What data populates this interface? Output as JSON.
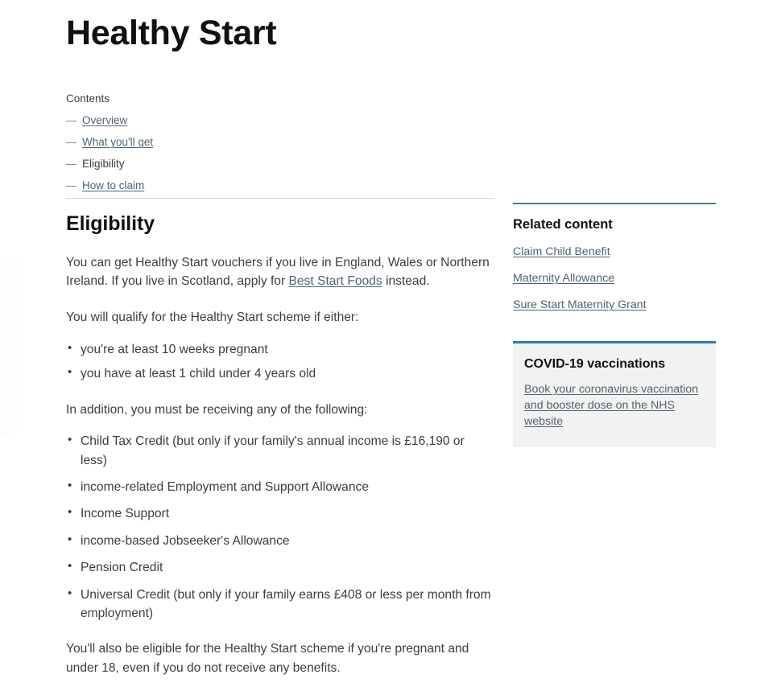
{
  "page": {
    "title": "Healthy Start"
  },
  "contents": {
    "label": "Contents",
    "dash": "—",
    "items": [
      {
        "label": "Overview",
        "current": false
      },
      {
        "label": "What you'll get",
        "current": false
      },
      {
        "label": "Eligibility",
        "current": true
      },
      {
        "label": "How to claim",
        "current": false
      }
    ]
  },
  "main": {
    "section_title": "Eligibility",
    "intro_before_link": "You can get Healthy Start vouchers if you live in England, Wales or Northern Ireland. If you live in Scotland, apply for ",
    "intro_link": "Best Start Foods",
    "intro_after_link": " instead.",
    "qualify_lead": "You will qualify for the Healthy Start scheme if either:",
    "qualify_items": [
      "you're at least 10 weeks pregnant",
      "you have at least 1 child under 4 years old"
    ],
    "benefits_lead": "In addition, you must be receiving any of the following:",
    "benefits_items": [
      "Child Tax Credit (but only if your family's annual income is £16,190 or less)",
      "income-related Employment and Support Allowance",
      "Income Support",
      "income-based Jobseeker's Allowance",
      "Pension Credit",
      "Universal Credit (but only if your family earns £408 or less per month from employment)"
    ],
    "closing": "You'll also be eligible for the Healthy Start scheme if you're pregnant and under 18, even if you do not receive any benefits."
  },
  "sidebar": {
    "related": {
      "title": "Related content",
      "links": [
        "Claim Child Benefit",
        "Maternity Allowance",
        "Sure Start Maternity Grant"
      ]
    },
    "callout": {
      "title": "COVID-19 vaccinations",
      "link": "Book your coronavirus vaccination and booster dose on the NHS website"
    }
  },
  "colors": {
    "link": "#4d6472",
    "related_border": "#4a7e8f",
    "callout_border": "#2b7cb5",
    "callout_background": "#f2f2f0",
    "text": "#3d3d3d",
    "heading": "#111111",
    "rule": "#d8d8d8"
  }
}
